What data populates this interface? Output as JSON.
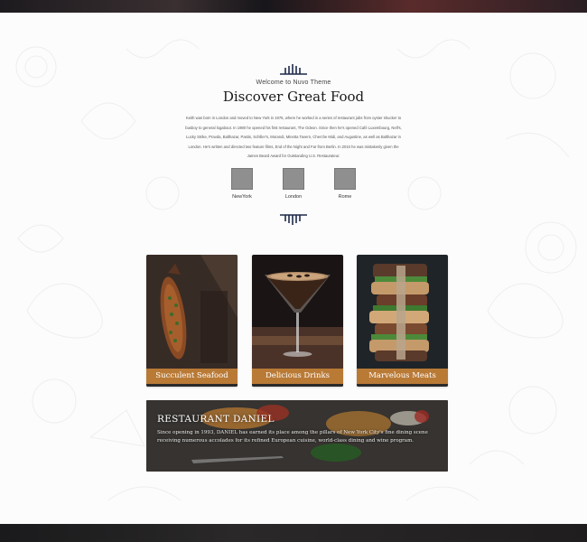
{
  "section": {
    "welcome": "Welcome to Nuvo Theme",
    "title": "Discover Great Food",
    "intro": "Keith was born in London and moved to New York in 1975, where he worked in a series of restaurant jobs from oyster shucker to busboy to general logabout. In 1980 he opened his first restaurant, The Odeon. Since then he's opened Café Luxembourg, Nell's, Lucky Strike, Pravda, Balthazar, Pastis, Schiller's, Morandi, Minetta Tavern, Cherche Midi, and Augustine, as well as Balthazar in London. He's written and directed two feature films, End of the Night and Far from Berlin. In 2010 he was mistakenly given the James Beard Award for Outstanding U.S. Restaurateur."
  },
  "locations": [
    {
      "label": "NewYork"
    },
    {
      "label": "London"
    },
    {
      "label": "Rome"
    }
  ],
  "cards": [
    {
      "label": "Succulent Seafood",
      "image": "grilled-fish"
    },
    {
      "label": "Delicious Drinks",
      "image": "espresso-martini"
    },
    {
      "label": "Marvelous Meats",
      "image": "stacked-sandwiches"
    }
  ],
  "banner": {
    "title": "RESTAURANT DANIEL",
    "text": "Since opening in 1993, DANIEL has earned its place among the pillars of New York City's fine dining scene receiving numerous accolades for its refined European cuisine, world-class dining and wine program."
  },
  "colors": {
    "accent": "#b97a36",
    "ornament": "#1e2a4a"
  }
}
